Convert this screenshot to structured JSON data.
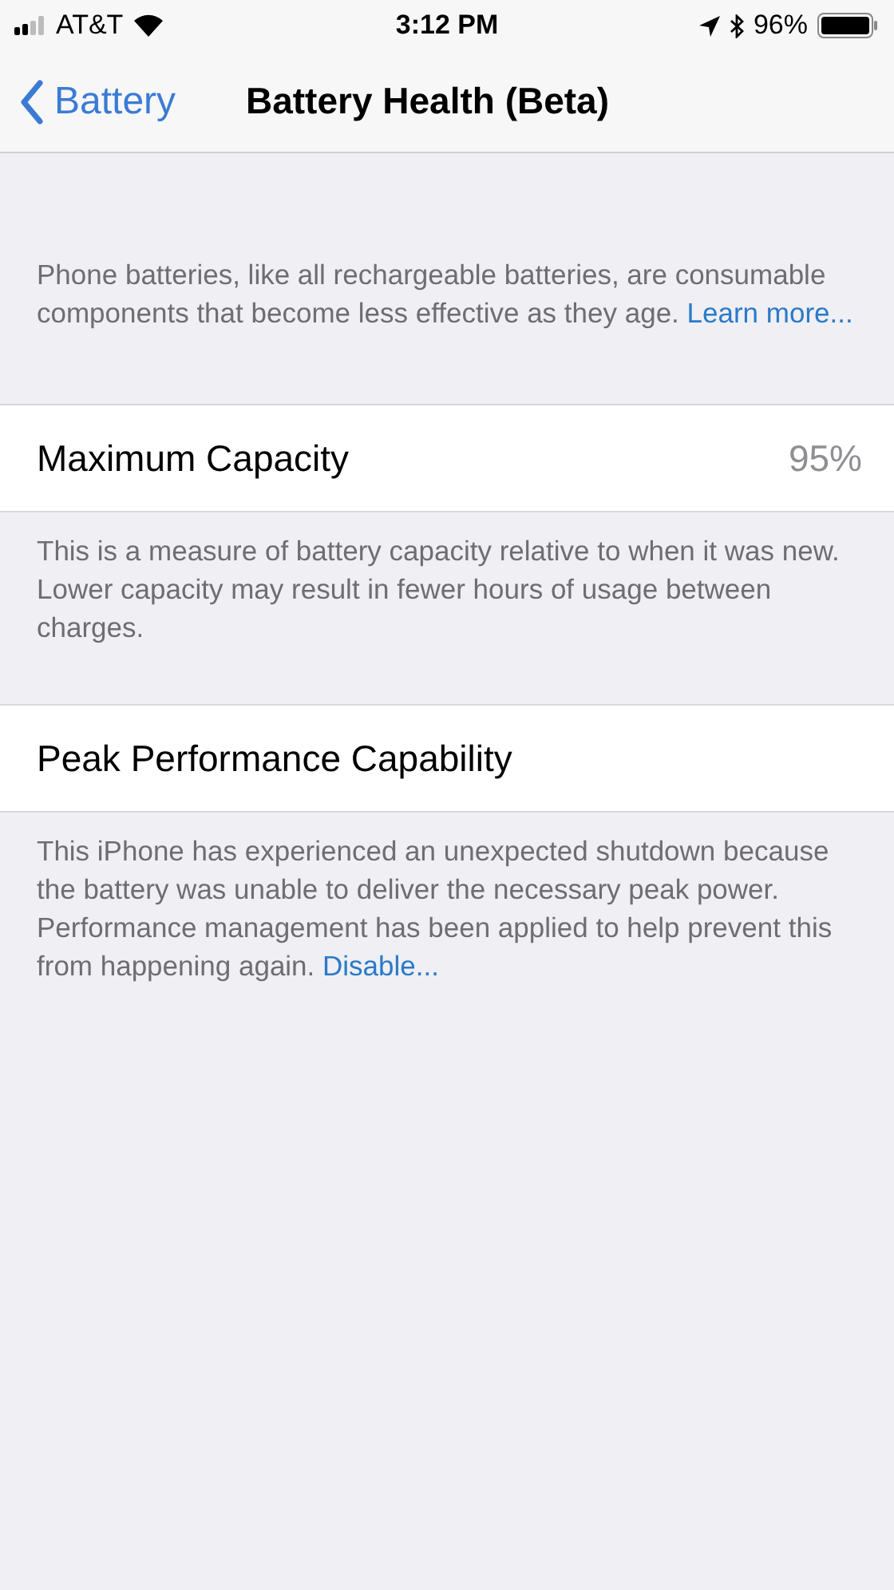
{
  "status_bar": {
    "carrier": "AT&T",
    "time": "3:12 PM",
    "battery_percent": "96%"
  },
  "nav_bar": {
    "back_label": "Battery",
    "title": "Battery Health (Beta)"
  },
  "intro": {
    "text": "Phone batteries, like all rechargeable batteries, are consumable components that become less effective as they age. ",
    "link": "Learn more..."
  },
  "sections": [
    {
      "label": "Maximum Capacity",
      "value": "95%",
      "footer": "This is a measure of battery capacity relative to when it was new. Lower capacity may result in fewer hours of usage between charges."
    },
    {
      "label": "Peak Performance Capability",
      "footer": "This iPhone has experienced an unexpected shutdown because the battery was unable to deliver the necessary peak power. Performance management has been applied to help prevent this from happening again. ",
      "footer_link": "Disable..."
    }
  ]
}
